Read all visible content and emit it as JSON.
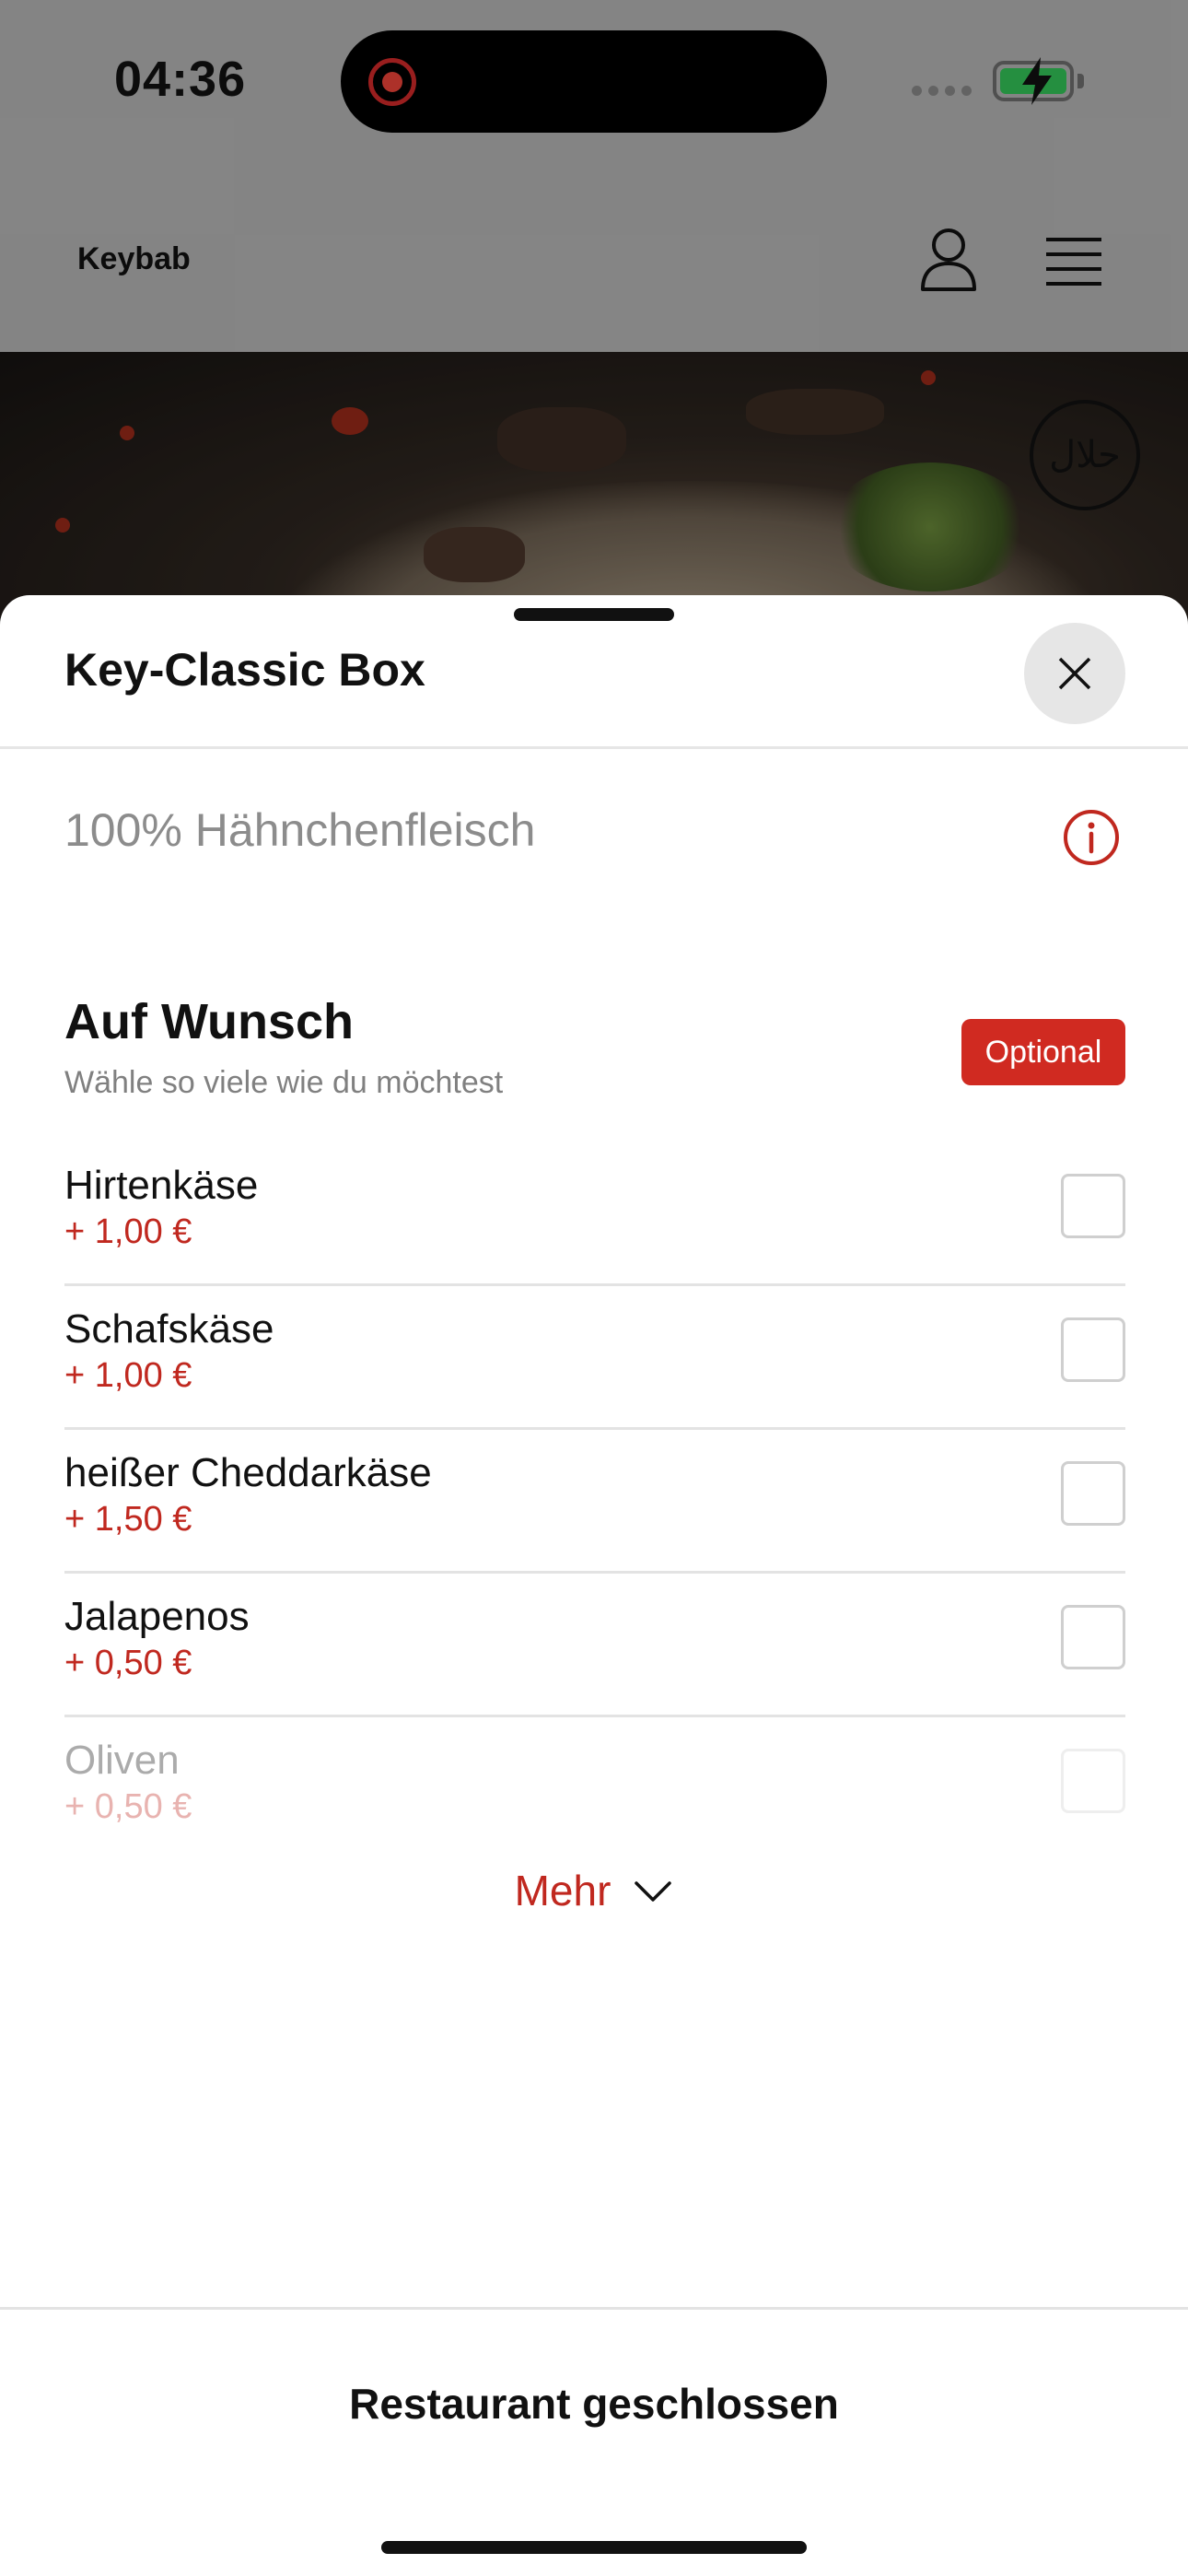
{
  "status_bar": {
    "time": "04:36",
    "battery_charging": true,
    "icons": [
      "screen-recording-icon",
      "signal-icon",
      "battery-charging-icon"
    ]
  },
  "header": {
    "brand": "Keybab",
    "icons": [
      "user-icon",
      "menu-icon"
    ]
  },
  "hero": {
    "badge_icon": "halal-icon"
  },
  "sheet": {
    "title": "Key-Classic Box",
    "close_icon": "close-icon",
    "description": "100% Hähnchenfleisch",
    "info_icon": "info-icon",
    "group": {
      "title": "Auf Wunsch",
      "subtitle": "Wähle so viele wie du möchtest",
      "badge": "Optional",
      "options": [
        {
          "name": "Hirtenkäse",
          "price": "+ 1,00 €",
          "checked": false
        },
        {
          "name": "Schafskäse",
          "price": "+ 1,00 €",
          "checked": false
        },
        {
          "name": "heißer Cheddarkäse",
          "price": "+ 1,50 €",
          "checked": false
        },
        {
          "name": "Jalapenos",
          "price": "+ 0,50 €",
          "checked": false
        },
        {
          "name": "Oliven",
          "price": "+ 0,50 €",
          "checked": false
        }
      ]
    },
    "more_label": "Mehr",
    "footer_label": "Restaurant geschlossen"
  },
  "colors": {
    "accent": "#c0281f",
    "badge_bg": "#d02a21",
    "description_text": "#8c8c8c"
  }
}
